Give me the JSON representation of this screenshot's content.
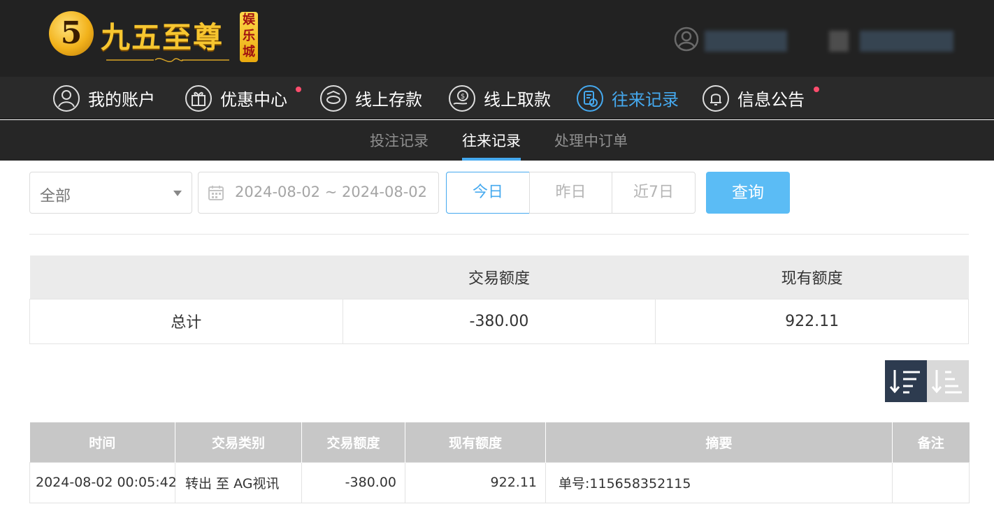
{
  "brand": {
    "logo_numeral": "5",
    "name": "九五至尊",
    "badge": [
      "娱",
      "乐",
      "城"
    ]
  },
  "main_nav": [
    {
      "label": "我的账户",
      "icon": "user-circle-icon",
      "active": false,
      "dot": false
    },
    {
      "label": "优惠中心",
      "icon": "gift-icon",
      "active": false,
      "dot": true
    },
    {
      "label": "线上存款",
      "icon": "deposit-icon",
      "active": false,
      "dot": false
    },
    {
      "label": "线上取款",
      "icon": "withdraw-icon",
      "active": false,
      "dot": false
    },
    {
      "label": "往来记录",
      "icon": "records-icon",
      "active": true,
      "dot": false
    },
    {
      "label": "信息公告",
      "icon": "bell-icon",
      "active": false,
      "dot": true
    }
  ],
  "sub_nav": [
    {
      "label": "投注记录",
      "active": false
    },
    {
      "label": "往来记录",
      "active": true
    },
    {
      "label": "处理中订单",
      "active": false
    }
  ],
  "filters": {
    "type_select": "全部",
    "date_range": "2024-08-02 ~ 2024-08-02",
    "quick_ranges": [
      "今日",
      "昨日",
      "近7日"
    ],
    "active_quick": "今日",
    "query_button": "查询"
  },
  "summary": {
    "headers": [
      "",
      "交易额度",
      "现有额度"
    ],
    "row": [
      "总计",
      "-380.00",
      "922.11"
    ]
  },
  "records": {
    "headers": [
      "时间",
      "交易类别",
      "交易额度",
      "现有额度",
      "摘要",
      "备注"
    ],
    "rows": [
      [
        "2024-08-02 00:05:42",
        "转出 至 AG视讯",
        "-380.00",
        "922.11",
        "单号:115658352115",
        ""
      ]
    ]
  },
  "colors": {
    "header_bg": "#222222",
    "accent": "#45a9ef",
    "query_button": "#5bbcf5",
    "notification_dot": "#ff4d6d"
  }
}
